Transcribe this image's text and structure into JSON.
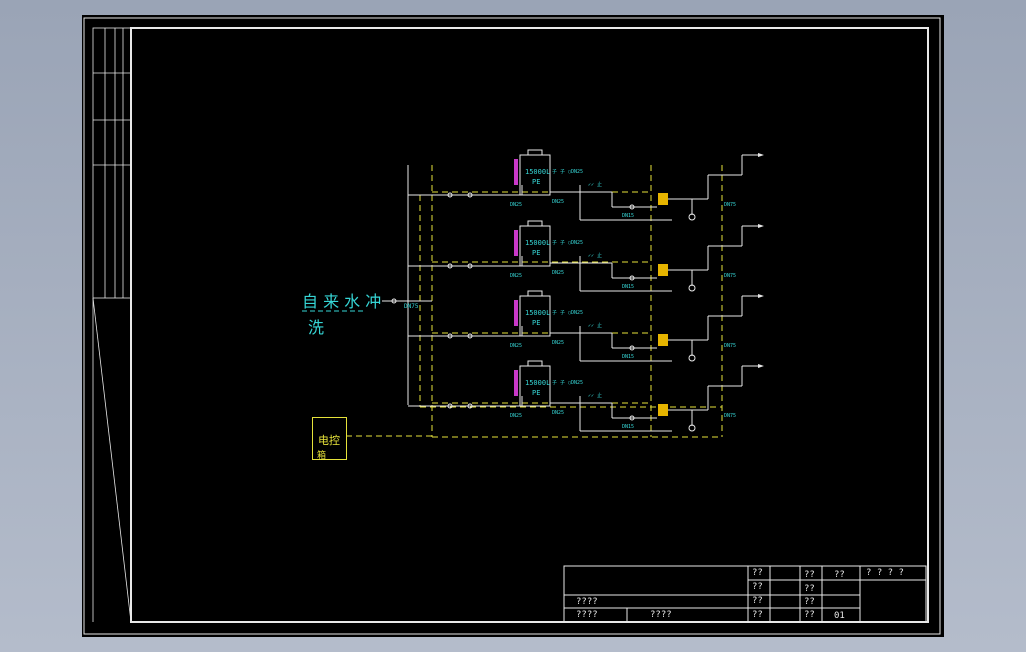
{
  "drawing": {
    "source_label": "自来水冲洗",
    "source_label_line1": "自 来 水 冲",
    "source_label_line2": "洗",
    "control_box_line1": "电控",
    "control_box_line2": "箱",
    "inlet_size": "DN75",
    "tanks": [
      {
        "capacity": "15000L",
        "material": "PE"
      },
      {
        "capacity": "15000L",
        "material": "PE"
      },
      {
        "capacity": "15000L",
        "material": "PE"
      },
      {
        "capacity": "15000L",
        "material": "PE"
      }
    ],
    "pipe_sizes": {
      "tank_inlet": "DN25",
      "tank_outlet": "DN25",
      "branch": "DN25",
      "pump_outlet": "DN25",
      "small": "DN15",
      "row_inlet": "DN25",
      "outlet_main": "DN75"
    }
  },
  "title_block": {
    "cell_a1": "??",
    "cell_a2": "??",
    "cell_a3": "??",
    "cell_a4": "??",
    "cell_b1": "??",
    "cell_b2": "??",
    "cell_b3": "??",
    "cell_b4": "??",
    "cell_c1": "??",
    "cell_d1": "? ? ? ?",
    "left_row3": "????",
    "left_row4a": "????",
    "left_row4b": "????",
    "sheet_no": "01"
  },
  "colors": {
    "line": "#e8e8e8",
    "annotation": "#36d6d6",
    "control": "#e6e23a",
    "valve_actuator": "#c838c8",
    "pump": "#e6b400"
  }
}
